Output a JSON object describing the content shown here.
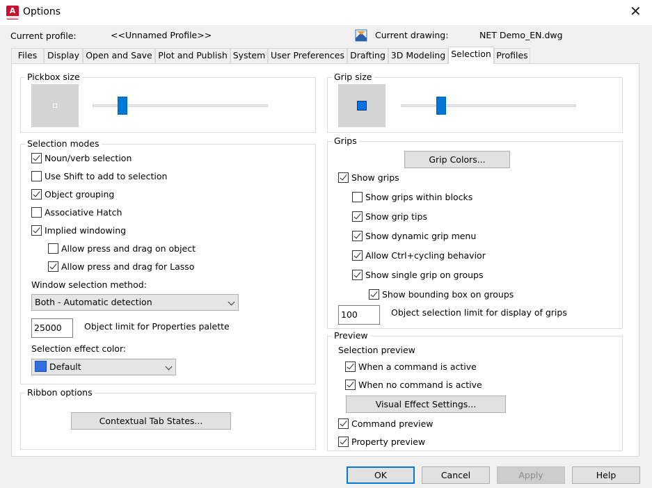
{
  "window": {
    "title": "Options",
    "app_icon_letter": "A"
  },
  "header": {
    "current_profile_label": "Current profile:",
    "current_profile_value": "<<Unnamed Profile>>",
    "current_drawing_label": "Current drawing:",
    "current_drawing_value": "NET Demo_EN.dwg"
  },
  "tabs": [
    "Files",
    "Display",
    "Open and Save",
    "Plot and Publish",
    "System",
    "User Preferences",
    "Drafting",
    "3D Modeling",
    "Selection",
    "Profiles"
  ],
  "active_tab": "Selection",
  "pickbox": {
    "title": "Pickbox size",
    "slider_level": 0.17
  },
  "grip_size": {
    "title": "Grip size",
    "slider_level": 0.23
  },
  "selection_modes": {
    "title": "Selection modes",
    "options": [
      {
        "label": "Noun/verb selection",
        "checked": true
      },
      {
        "label": "Use Shift to add to selection",
        "checked": false
      },
      {
        "label": "Object grouping",
        "checked": true
      },
      {
        "label": "Associative Hatch",
        "checked": false
      },
      {
        "label": "Implied windowing",
        "checked": true
      },
      {
        "label": "Allow press and drag on object",
        "checked": false
      },
      {
        "label": "Allow press and drag for Lasso",
        "checked": true
      }
    ],
    "window_method_label": "Window selection method:",
    "window_method_value": "Both - Automatic detection",
    "object_limit_value": "25000",
    "object_limit_label": "Object limit for Properties palette",
    "effect_color_label": "Selection effect color:",
    "effect_color_value": "Default",
    "effect_color_swatch": "#2f6fe0"
  },
  "ribbon": {
    "title": "Ribbon options",
    "button": "Contextual Tab States..."
  },
  "grips": {
    "title": "Grips",
    "colors_button": "Grip Colors...",
    "options": [
      {
        "label": "Show grips",
        "checked": true
      },
      {
        "label": "Show grips within blocks",
        "checked": false
      },
      {
        "label": "Show grip tips",
        "checked": true
      },
      {
        "label": "Show dynamic grip menu",
        "checked": true
      },
      {
        "label": "Allow Ctrl+cycling behavior",
        "checked": true
      },
      {
        "label": "Show single grip on groups",
        "checked": true
      },
      {
        "label": "Show bounding box on groups",
        "checked": true
      }
    ],
    "limit_value": "100",
    "limit_label": "Object selection limit for display of grips"
  },
  "preview": {
    "title": "Preview",
    "selection_preview_label": "Selection preview",
    "options": [
      {
        "label": "When a command is active",
        "checked": true
      },
      {
        "label": "When no command is active",
        "checked": true
      },
      {
        "label": "Command preview",
        "checked": true
      },
      {
        "label": "Property preview",
        "checked": true
      }
    ],
    "visual_button": "Visual Effect Settings..."
  },
  "footer": {
    "ok": "OK",
    "cancel": "Cancel",
    "apply": "Apply",
    "help": "Help"
  },
  "colors": {
    "accent": "#0078d7",
    "slider_thumb": "#0078d7",
    "grip_square": "#0a6fe0"
  }
}
